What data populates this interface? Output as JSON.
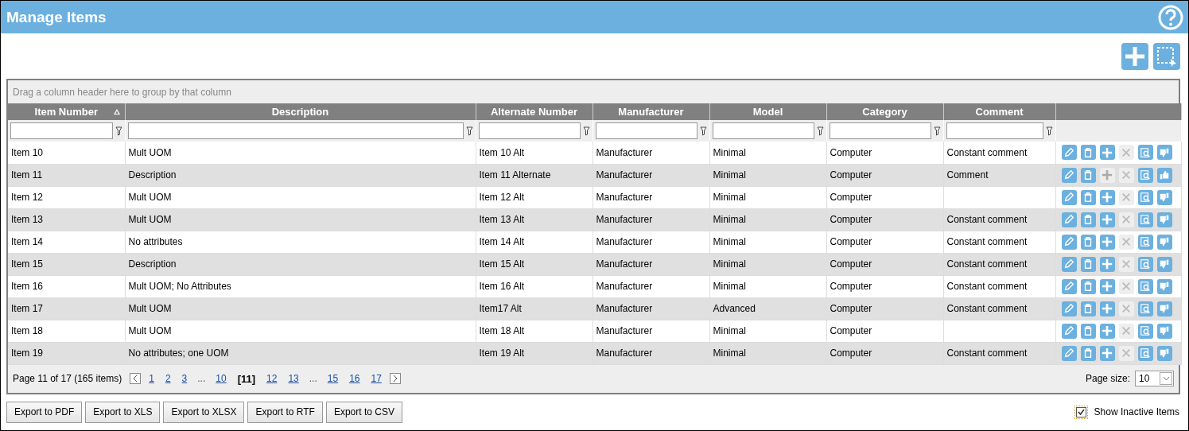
{
  "window": {
    "title": "Manage Items"
  },
  "group_panel": {
    "hint": "Drag a column header here to group by that column"
  },
  "table": {
    "columns": [
      {
        "label": "Item Number",
        "sorted": true
      },
      {
        "label": "Description",
        "sorted": false
      },
      {
        "label": "Alternate Number",
        "sorted": false
      },
      {
        "label": "Manufacturer",
        "sorted": false
      },
      {
        "label": "Model",
        "sorted": false
      },
      {
        "label": "Category",
        "sorted": false
      },
      {
        "label": "Comment",
        "sorted": false
      }
    ],
    "rows": [
      {
        "cells": [
          "Item 10",
          "Mult UOM",
          "Item 10 Alt",
          "Manufacturer",
          "Minimal",
          "Computer",
          "Constant comment"
        ],
        "add_enabled": true,
        "liked": false
      },
      {
        "cells": [
          "Item 11",
          "Description",
          "Item 11 Alternate",
          "Manufacturer",
          "Minimal",
          "Computer",
          "Comment"
        ],
        "add_enabled": false,
        "liked": true
      },
      {
        "cells": [
          "Item 12",
          "Mult UOM",
          "Item 12 Alt",
          "Manufacturer",
          "Minimal",
          "Computer",
          ""
        ],
        "add_enabled": true,
        "liked": false
      },
      {
        "cells": [
          "Item 13",
          "Mult UOM",
          "Item 13 Alt",
          "Manufacturer",
          "Minimal",
          "Computer",
          "Constant comment"
        ],
        "add_enabled": true,
        "liked": false
      },
      {
        "cells": [
          "Item 14",
          "No attributes",
          "Item 14 Alt",
          "Manufacturer",
          "Minimal",
          "Computer",
          "Constant comment"
        ],
        "add_enabled": true,
        "liked": false
      },
      {
        "cells": [
          "Item 15",
          "Description",
          "Item 15 Alt",
          "Manufacturer",
          "Minimal",
          "Computer",
          "Constant comment"
        ],
        "add_enabled": true,
        "liked": false
      },
      {
        "cells": [
          "Item 16",
          "Mult UOM; No Attributes",
          "Item 16 Alt",
          "Manufacturer",
          "Minimal",
          "Computer",
          "Constant comment"
        ],
        "add_enabled": true,
        "liked": false
      },
      {
        "cells": [
          "Item 17",
          "Mult UOM",
          "Item17 Alt",
          "Manufacturer",
          "Advanced",
          "Computer",
          "Constant comment"
        ],
        "add_enabled": true,
        "liked": false
      },
      {
        "cells": [
          "Item 18",
          "Mult UOM",
          "Item 18 Alt",
          "Manufacturer",
          "Minimal",
          "Computer",
          ""
        ],
        "add_enabled": true,
        "liked": false
      },
      {
        "cells": [
          "Item 19",
          "No attributes; one UOM",
          "Item 19 Alt",
          "Manufacturer",
          "Minimal",
          "Computer",
          "Constant comment"
        ],
        "add_enabled": true,
        "liked": false
      }
    ]
  },
  "pager": {
    "summary": "Page 11 of 17 (165 items)",
    "pages": [
      {
        "kind": "page",
        "label": "1",
        "selected": false
      },
      {
        "kind": "page",
        "label": "2",
        "selected": false
      },
      {
        "kind": "page",
        "label": "3",
        "selected": false
      },
      {
        "kind": "ellipsis",
        "label": "..."
      },
      {
        "kind": "page",
        "label": "10",
        "selected": false
      },
      {
        "kind": "page",
        "label": "[11]",
        "selected": true
      },
      {
        "kind": "page",
        "label": "12",
        "selected": false
      },
      {
        "kind": "page",
        "label": "13",
        "selected": false
      },
      {
        "kind": "ellipsis",
        "label": "..."
      },
      {
        "kind": "page",
        "label": "15",
        "selected": false
      },
      {
        "kind": "page",
        "label": "16",
        "selected": false
      },
      {
        "kind": "page",
        "label": "17",
        "selected": false
      }
    ],
    "page_size_label": "Page size:",
    "page_size": "10"
  },
  "export_buttons": [
    "Export to PDF",
    "Export to XLS",
    "Export to XLSX",
    "Export to RTF",
    "Export to CSV"
  ],
  "show_inactive": {
    "label": "Show Inactive Items",
    "checked": true
  }
}
